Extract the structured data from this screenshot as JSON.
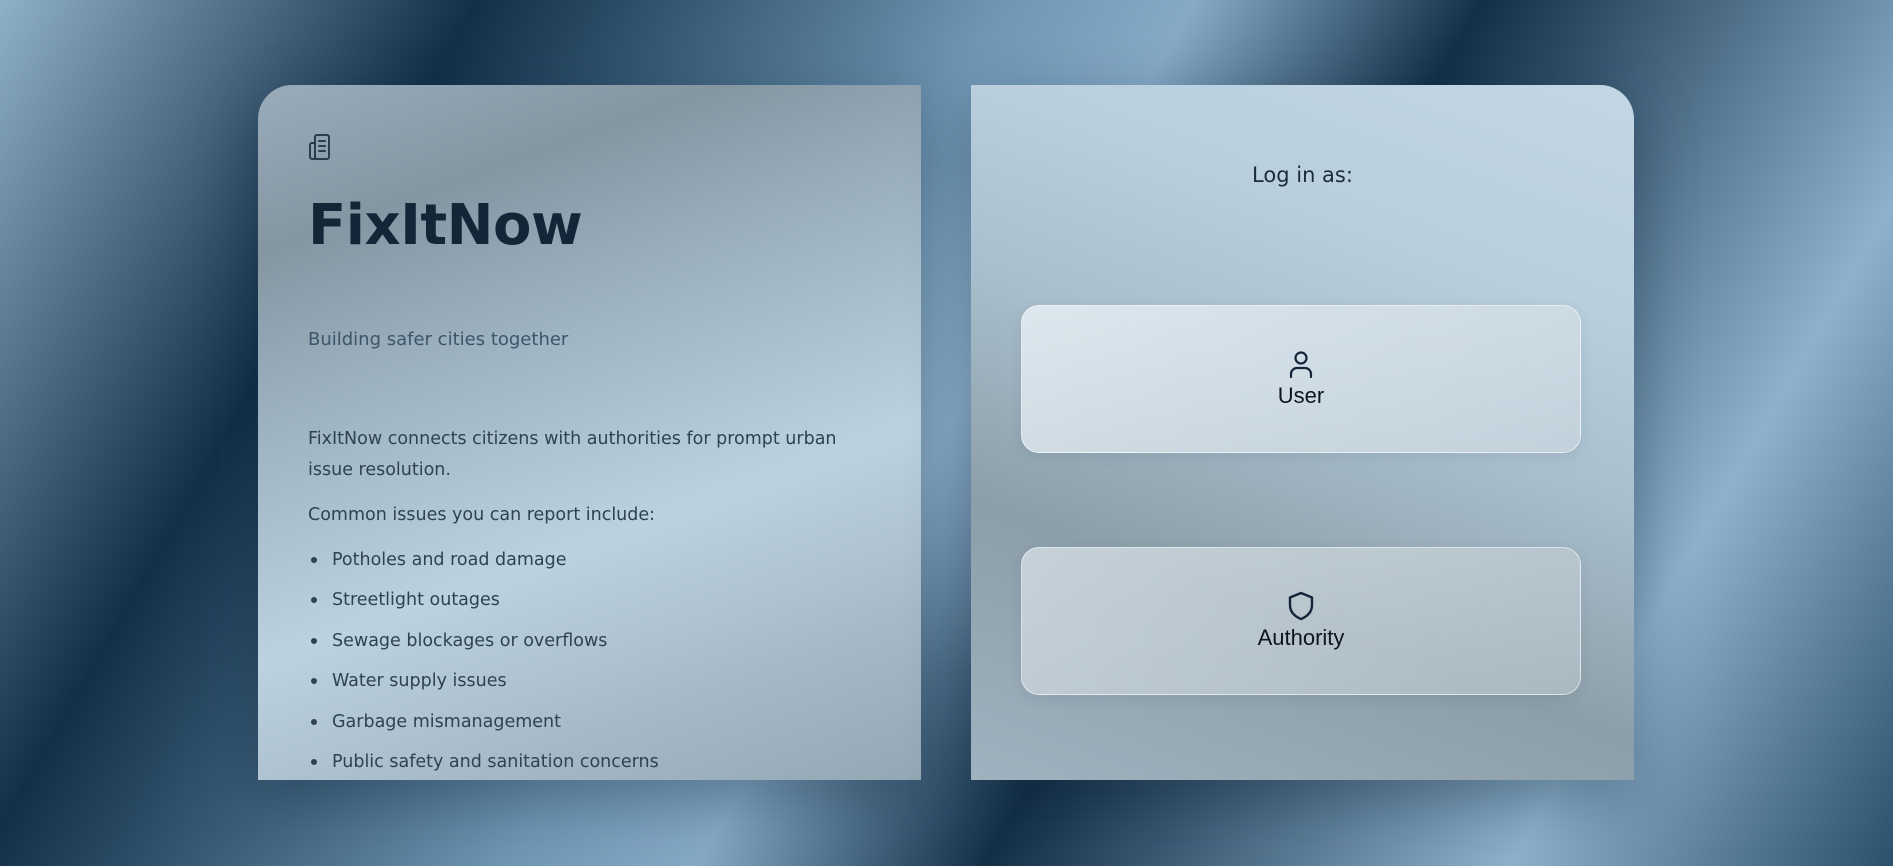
{
  "brand": {
    "logo_icon": "building-icon",
    "title": "FixItNow",
    "tagline": "Building safer cities together"
  },
  "about": {
    "intro": "FixItNow connects citizens with authorities for prompt urban issue resolution.",
    "issues_heading": "Common issues you can report include:",
    "issues": [
      "Potholes and road damage",
      "Streetlight outages",
      "Sewage blockages or overflows",
      "Water supply issues",
      "Garbage mismanagement",
      "Public safety and sanitation concerns"
    ]
  },
  "login": {
    "heading": "Log in as:",
    "roles": [
      {
        "label": "User",
        "icon": "user-icon"
      },
      {
        "label": "Authority",
        "icon": "shield-icon"
      }
    ]
  },
  "colors": {
    "text_dark": "#142538",
    "text_body": "#2e4254",
    "background_dark": "#123049",
    "background_light": "#8fb0c8"
  }
}
